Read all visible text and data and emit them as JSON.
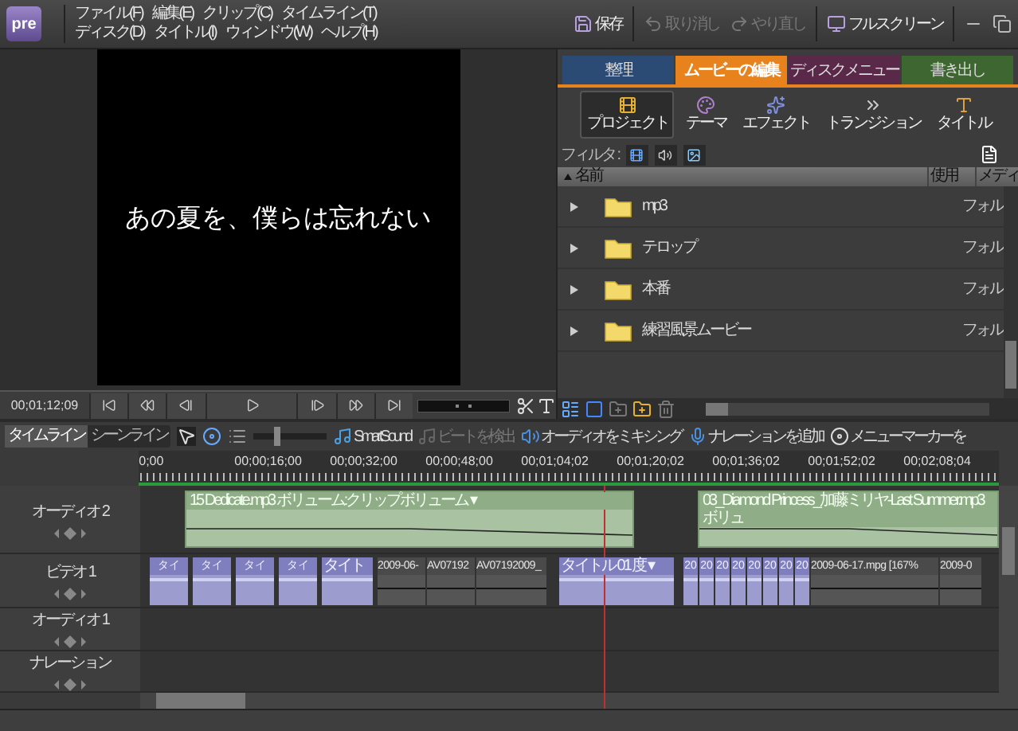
{
  "app_logo": "pre",
  "menu": [
    "ファイル(F)",
    "編集(E)",
    "クリップ(C)",
    "タイムライン(T)",
    "ディスク(D)",
    "タイトル(I)",
    "ウィンドウ(W)",
    "ヘルプ(H)"
  ],
  "toolbar": [
    {
      "label": "保存",
      "kind": "save",
      "disabled": false
    },
    {
      "label": "取り消し",
      "kind": "undo",
      "disabled": true
    },
    {
      "label": "やり直し",
      "kind": "redo",
      "disabled": true
    },
    {
      "label": "フルスクリーン",
      "kind": "fullscreen",
      "disabled": false
    }
  ],
  "monitor": {
    "caption": "あの夏を、僕らは忘れない",
    "timecode": "00;01;12;09"
  },
  "tabs": [
    {
      "label": "整理",
      "selected": false,
      "color": "#2b4a74"
    },
    {
      "label": "ムービーの編集",
      "selected": true,
      "color": "#e8821c"
    },
    {
      "label": "ディスクメニュー",
      "selected": false,
      "color": "#5a2848"
    },
    {
      "label": "書き出し",
      "selected": false,
      "color": "#3d6630"
    }
  ],
  "views": [
    {
      "label": "プロジェクト",
      "kind": "project",
      "selected": true
    },
    {
      "label": "テーマ",
      "kind": "theme",
      "selected": false
    },
    {
      "label": "エフェクト",
      "kind": "effect",
      "selected": false
    },
    {
      "label": "トランジション",
      "kind": "transition",
      "selected": false
    },
    {
      "label": "タイトル",
      "kind": "title",
      "selected": false
    }
  ],
  "filter": {
    "label": "フィルタ :"
  },
  "project": {
    "columns": [
      "名前",
      "使用",
      "メディ"
    ],
    "rows": [
      {
        "name": "mp3",
        "type": "フォル"
      },
      {
        "name": "テロップ",
        "type": "フォル"
      },
      {
        "name": "本番",
        "type": "フォル"
      },
      {
        "name": "練習風景ムービー",
        "type": "フォル"
      }
    ]
  },
  "timeline": {
    "tabs": [
      {
        "label": "タイムライン",
        "selected": true
      },
      {
        "label": "シーンライン",
        "selected": false
      }
    ],
    "zoom": {
      "level": 0.3
    },
    "actions": [
      {
        "label": "SmartSound",
        "kind": "smartsound",
        "disabled": false
      },
      {
        "label": "ビートを検出",
        "kind": "beat",
        "disabled": true
      },
      {
        "label": "オーディオをミキシング",
        "kind": "mix",
        "disabled": false
      },
      {
        "label": "ナレーションを追加",
        "kind": "narration",
        "disabled": false
      },
      {
        "label": "メニューマーカーを",
        "kind": "marker",
        "disabled": false
      }
    ],
    "ruler": [
      "0;00",
      "00;00;16;00",
      "00;00;32;00",
      "00;00;48;00",
      "00;01;04;02",
      "00;01;20;02",
      "00;01;36;02",
      "00;01;52;02",
      "00;02;08;04"
    ],
    "tracks": [
      {
        "name": "オーディオ 2",
        "kind": "audio",
        "clips": [
          {
            "label": "15 Dedicate.mp3 ボリューム:クリップボリューム ▾",
            "kind": "audio"
          },
          {
            "label": "03_Diamond Princess_加藤ミリヤ-Last Summer.mp3 ボリュ",
            "kind": "audio"
          }
        ]
      },
      {
        "name": "ビデオ 1",
        "kind": "video",
        "clips": [
          {
            "label": "タイ",
            "kind": "title"
          },
          {
            "label": "タイ",
            "kind": "title"
          },
          {
            "label": "タイ",
            "kind": "title"
          },
          {
            "label": "タイ",
            "kind": "title"
          },
          {
            "label": "タイト",
            "kind": "title"
          },
          {
            "label": "2009-06-",
            "kind": "video"
          },
          {
            "label": "AV07192",
            "kind": "video"
          },
          {
            "label": "AV07192009_",
            "kind": "video"
          },
          {
            "label": "タイトル 01 度 ▾",
            "kind": "title"
          },
          {
            "label": "20",
            "kind": "title"
          },
          {
            "label": "20",
            "kind": "title"
          },
          {
            "label": "20",
            "kind": "title"
          },
          {
            "label": "20",
            "kind": "title"
          },
          {
            "label": "20",
            "kind": "title"
          },
          {
            "label": "20",
            "kind": "title"
          },
          {
            "label": "20",
            "kind": "title"
          },
          {
            "label": "20",
            "kind": "title"
          },
          {
            "label": "2009-06-17.mpg [167%",
            "kind": "video"
          },
          {
            "label": "2009-0",
            "kind": "video"
          }
        ]
      },
      {
        "name": "オーディオ 1",
        "kind": "audio"
      },
      {
        "name": "ナレーション",
        "kind": "narration"
      }
    ]
  }
}
